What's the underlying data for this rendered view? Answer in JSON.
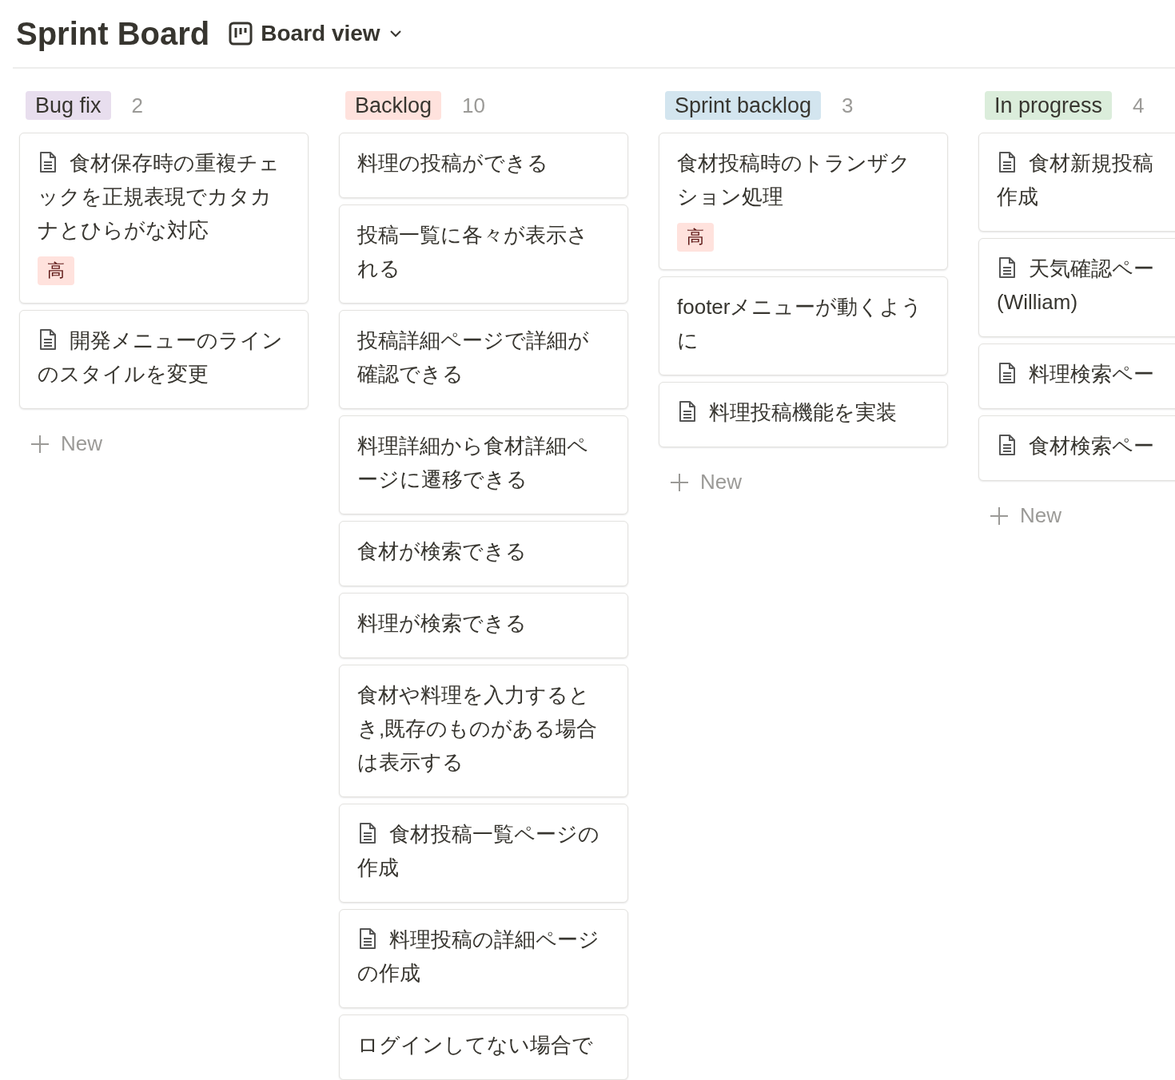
{
  "header": {
    "title": "Sprint Board",
    "view": "Board view"
  },
  "columns": [
    {
      "label": "Bug fix",
      "color": "#e8deee",
      "count": "2",
      "new": "New",
      "clipped": false,
      "cards": [
        {
          "title": "食材保存時の重複チェックを正規表現でカタカナとひらがな対応",
          "doc": true,
          "priority": "高"
        },
        {
          "title": "開発メニューのラインのスタイルを変更",
          "doc": true
        }
      ]
    },
    {
      "label": "Backlog",
      "color": "#ffe2dd",
      "count": "10",
      "clipped": false,
      "cards": [
        {
          "title": "料理の投稿ができる",
          "doc": false
        },
        {
          "title": "投稿一覧に各々が表示される",
          "doc": false
        },
        {
          "title": "投稿詳細ページで詳細が確認できる",
          "doc": false
        },
        {
          "title": "料理詳細から食材詳細ページに遷移できる",
          "doc": false
        },
        {
          "title": "食材が検索できる",
          "doc": false
        },
        {
          "title": "料理が検索できる",
          "doc": false
        },
        {
          "title": "食材や料理を入力するとき,既存のものがある場合は表示する",
          "doc": false
        },
        {
          "title": "食材投稿一覧ページの作成",
          "doc": true
        },
        {
          "title": "料理投稿の詳細ページの作成",
          "doc": true
        },
        {
          "title": "ログインしてない場合で",
          "doc": false
        }
      ]
    },
    {
      "label": "Sprint backlog",
      "color": "#d3e5ef",
      "count": "3",
      "new": "New",
      "clipped": false,
      "cards": [
        {
          "title": "食材投稿時のトランザクション処理",
          "doc": false,
          "priority": "高"
        },
        {
          "title": "footerメニューが動くように",
          "doc": false
        },
        {
          "title": "料理投稿機能を実装",
          "doc": true
        }
      ]
    },
    {
      "label": "In progress",
      "color": "#dbeddb",
      "count": "4",
      "new": "New",
      "clipped": true,
      "cards": [
        {
          "title": "食材新規投稿作成",
          "doc": true
        },
        {
          "title": "天気確認ペー(William)",
          "doc": true
        },
        {
          "title": "料理検索ペー",
          "doc": true
        },
        {
          "title": "食材検索ペー",
          "doc": true
        }
      ]
    }
  ]
}
